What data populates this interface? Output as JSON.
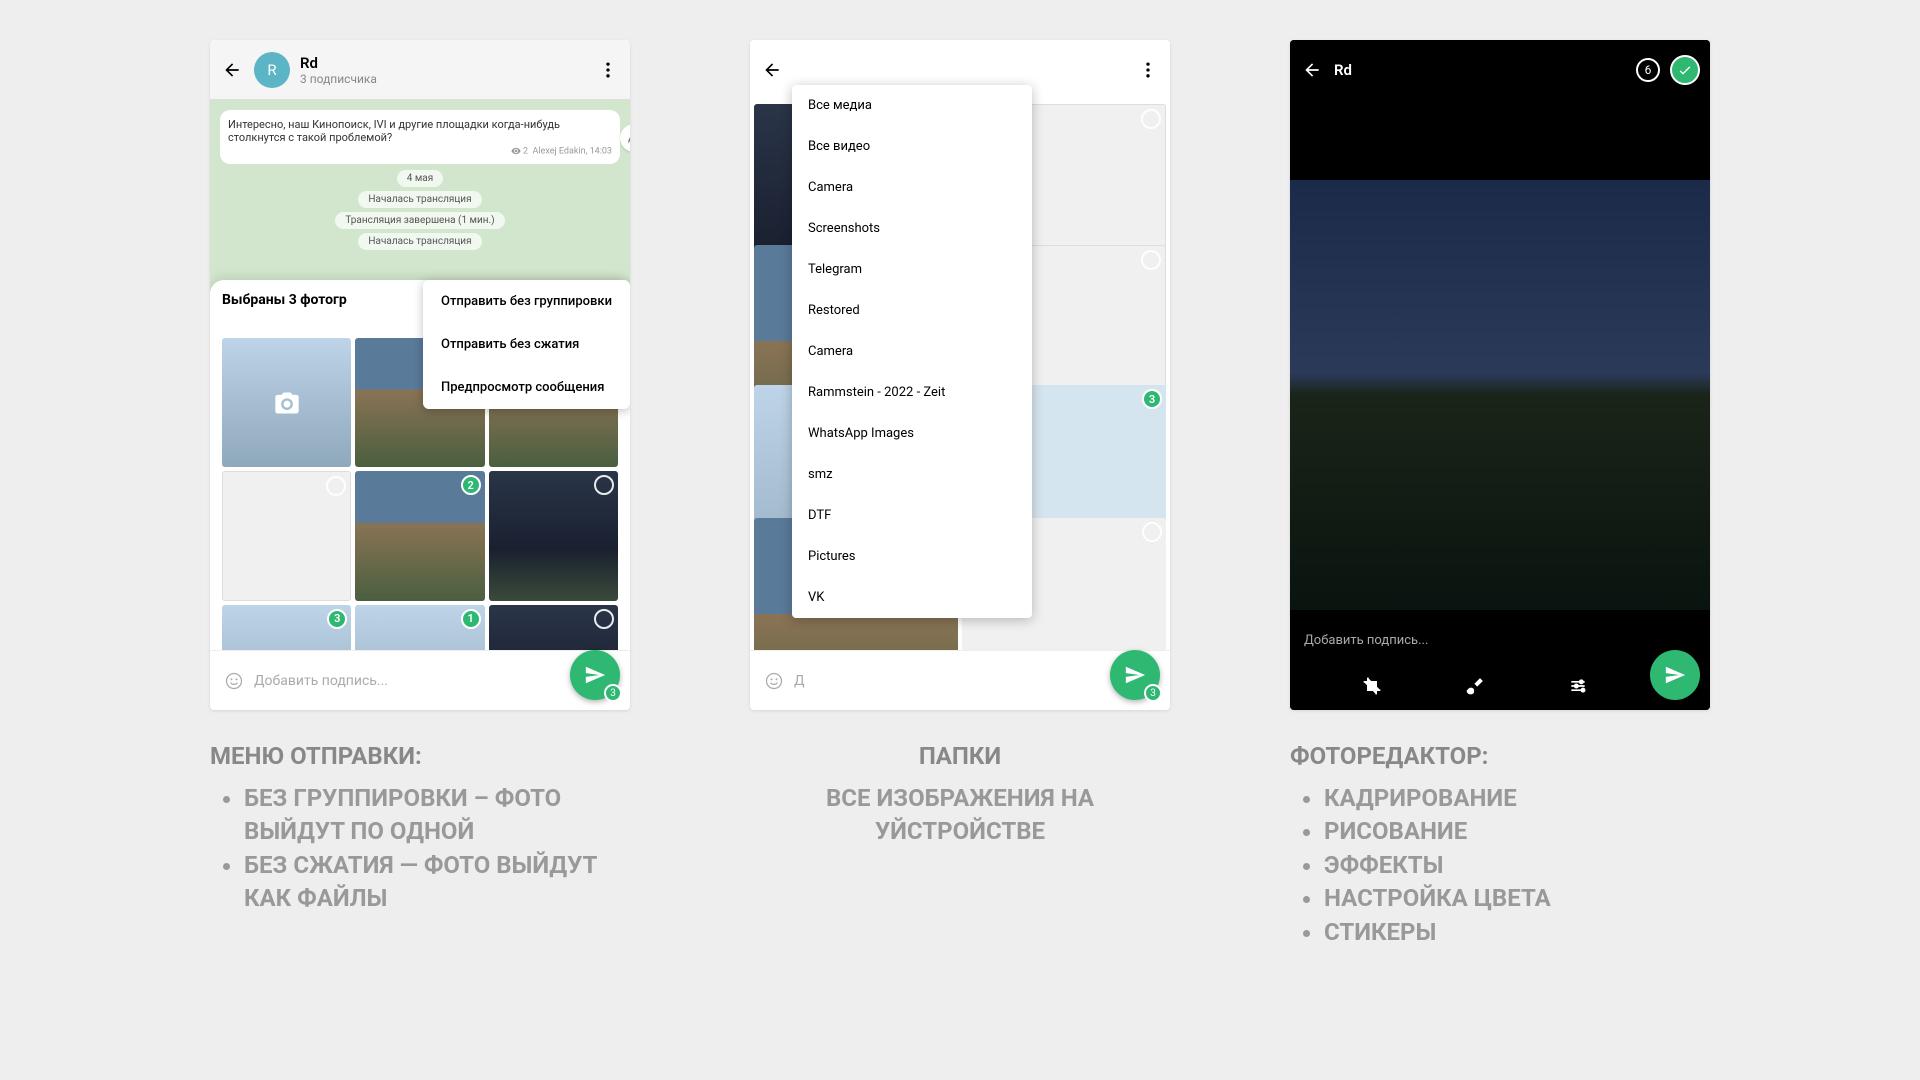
{
  "s1": {
    "channel": "Rd",
    "avatar": "R",
    "subs": "3 подписчика",
    "msg": "Интересно, наш Кинопоиск, IVI и другие площадки когда-нибудь столкнутся с такой проблемой?",
    "views": "2",
    "author": "Alexej Edakin, 14:03",
    "date": "4 мая",
    "sys1": "Началась трансляция",
    "sys2": "Трансляция завершена (1 мин.)",
    "sys3": "Началась трансляция",
    "sheet_title": "Выбраны 3 фотогр",
    "menu": [
      "Отправить без группировки",
      "Отправить без сжатия",
      "Предпросмотр сообщения"
    ],
    "badges": [
      "",
      "2",
      "",
      "3",
      "1",
      ""
    ],
    "caption_ph": "Добавить подпись...",
    "count": "3"
  },
  "s2": {
    "folders": [
      "Все медиа",
      "Все видео",
      "Camera",
      "Screenshots",
      "Telegram",
      "Restored",
      "Camera",
      "Rammstein - 2022 - Zeit",
      "WhatsApp Images",
      "smz",
      "DTF",
      "Pictures",
      "VK"
    ],
    "caption_ph": "Д",
    "count": "3",
    "g_badge": "3"
  },
  "s3": {
    "title": "Rd",
    "count": "6",
    "caption_ph": "Добавить подпись..."
  },
  "labels": {
    "l1_title": "МЕНЮ ОТПРАВКИ:",
    "l1_items": [
      "БЕЗ ГРУППИРОВКИ – ФОТО ВЫЙДУТ ПО ОДНОЙ",
      "БЕЗ СЖАТИЯ — ФОТО ВЫЙДУТ КАК ФАЙЛЫ"
    ],
    "l2_title": "ПАПКИ",
    "l2_sub": "ВСЕ ИЗОБРАЖЕНИЯ НА УЙСТРОЙСТВЕ",
    "l3_title": "ФОТОРЕДАКТОР:",
    "l3_items": [
      "КАДРИРОВАНИЕ",
      "РИСОВАНИЕ",
      "ЭФФЕКТЫ",
      "НАСТРОЙКА ЦВЕТА",
      "СТИКЕРЫ"
    ]
  }
}
